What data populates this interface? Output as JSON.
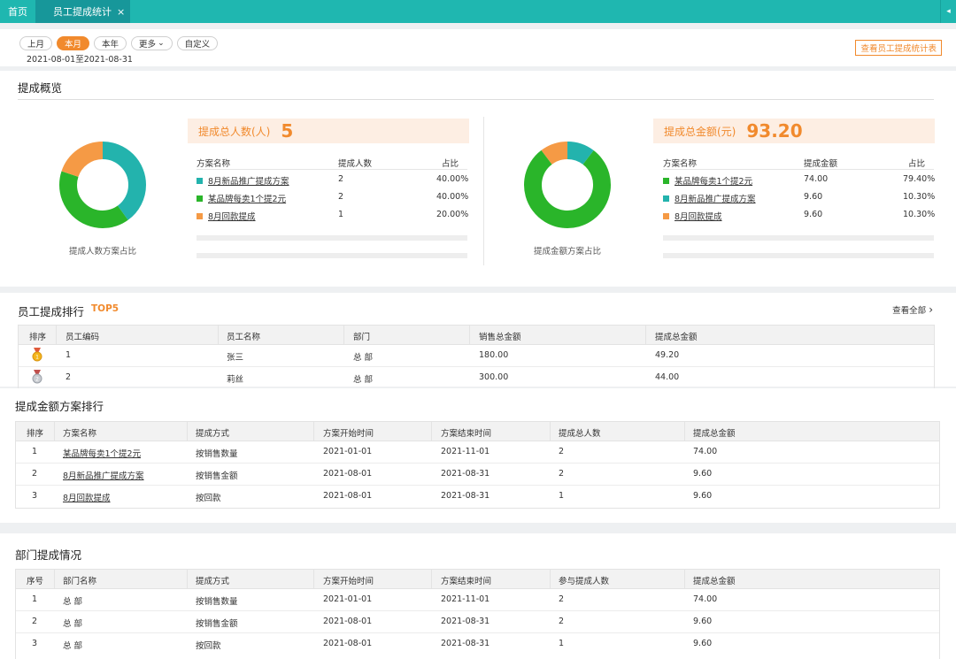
{
  "topbar": {
    "home": "首页",
    "tab": "员工提成统计",
    "tab_close": "×",
    "right_icon": "◂"
  },
  "period": {
    "chips": [
      {
        "label": "上月",
        "active": false
      },
      {
        "label": "本月",
        "active": true
      },
      {
        "label": "本年",
        "active": false
      },
      {
        "label": "更多",
        "active": false
      },
      {
        "label": "自定义",
        "active": false
      }
    ],
    "more_arrow": "⌄",
    "range": "2021-08-01至2021-08-31",
    "report_button": "查看员工提成统计表"
  },
  "overview": {
    "title": "提成概览",
    "people": {
      "kpi_label": "提成总人数(人)",
      "kpi_value": "5",
      "donut_label": "提成人数方案占比",
      "headers": [
        "方案名称",
        "提成人数",
        "占比"
      ],
      "rows": [
        {
          "name": "8月新品推广提成方案",
          "value": "2",
          "pct": "40.00%",
          "color": "#23b3ad",
          "share": 0.4
        },
        {
          "name": "某品牌每卖1个提2元",
          "value": "2",
          "pct": "40.00%",
          "color": "#2ab52a",
          "share": 0.4
        },
        {
          "name": "8月回款提成",
          "value": "1",
          "pct": "20.00%",
          "color": "#f59a45",
          "share": 0.2
        }
      ]
    },
    "amount": {
      "kpi_label": "提成总金额(元)",
      "kpi_value": "93.20",
      "donut_label": "提成金额方案占比",
      "headers": [
        "方案名称",
        "提成金额",
        "占比"
      ],
      "rows": [
        {
          "name": "某品牌每卖1个提2元",
          "value": "74.00",
          "pct": "79.40%",
          "color": "#2ab52a",
          "share": 0.794
        },
        {
          "name": "8月新品推广提成方案",
          "value": "9.60",
          "pct": "10.30%",
          "color": "#23b3ad",
          "share": 0.103
        },
        {
          "name": "8月回款提成",
          "value": "9.60",
          "pct": "10.30%",
          "color": "#f59a45",
          "share": 0.103
        }
      ]
    }
  },
  "ranking": {
    "title": "员工提成排行",
    "badge": "TOP5",
    "view_all": "查看全部",
    "view_all_arrow": "›",
    "headers": [
      "排序",
      "员工编码",
      "员工名称",
      "部门",
      "销售总金额",
      "提成总金额"
    ],
    "rows": [
      {
        "code": "1",
        "name": "张三",
        "dept": "总 部",
        "sales": "180.00",
        "commission": "49.20",
        "medal": "gold"
      },
      {
        "code": "2",
        "name": "莉丝",
        "dept": "总 部",
        "sales": "300.00",
        "commission": "44.00",
        "medal": "silver"
      }
    ]
  },
  "plans": {
    "title": "提成金额方案排行",
    "headers": [
      "排序",
      "方案名称",
      "提成方式",
      "方案开始时间",
      "方案结束时间",
      "提成总人数",
      "提成总金额"
    ],
    "rows": [
      {
        "rank": "1",
        "name": "某品牌每卖1个提2元",
        "method": "按销售数量",
        "start": "2021-01-01",
        "end": "2021-11-01",
        "people": "2",
        "amount": "74.00"
      },
      {
        "rank": "2",
        "name": "8月新品推广提成方案",
        "method": "按销售金额",
        "start": "2021-08-01",
        "end": "2021-08-31",
        "people": "2",
        "amount": "9.60"
      },
      {
        "rank": "3",
        "name": "8月回款提成",
        "method": "按回款",
        "start": "2021-08-01",
        "end": "2021-08-31",
        "people": "1",
        "amount": "9.60"
      }
    ]
  },
  "departments": {
    "title": "部门提成情况",
    "headers": [
      "序号",
      "部门名称",
      "提成方式",
      "方案开始时间",
      "方案结束时间",
      "参与提成人数",
      "提成总金额"
    ],
    "rows": [
      {
        "no": "1",
        "dept": "总 部",
        "method": "按销售数量",
        "start": "2021-01-01",
        "end": "2021-11-01",
        "people": "2",
        "amount": "74.00"
      },
      {
        "no": "2",
        "dept": "总 部",
        "method": "按销售金额",
        "start": "2021-08-01",
        "end": "2021-08-31",
        "people": "2",
        "amount": "9.60"
      },
      {
        "no": "3",
        "dept": "总 部",
        "method": "按回款",
        "start": "2021-08-01",
        "end": "2021-08-31",
        "people": "1",
        "amount": "9.60"
      }
    ]
  },
  "colors": {
    "accent": "#f18a2d",
    "topbar": "#1fb7b0",
    "tab_active": "#17979a"
  }
}
